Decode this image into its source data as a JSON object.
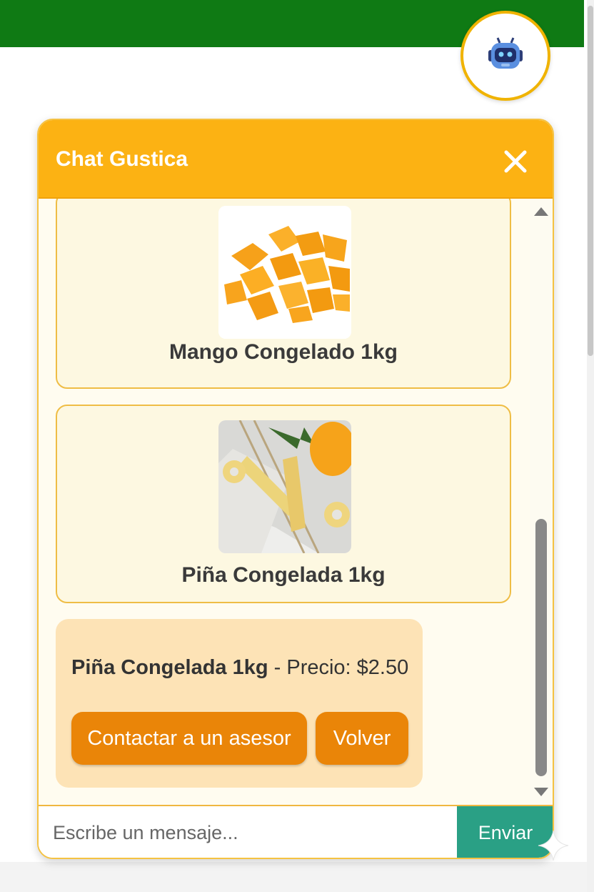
{
  "chat": {
    "title": "Chat Gustica",
    "products": [
      {
        "name": "Mango Congelado 1kg"
      },
      {
        "name": "Piña Congelada 1kg"
      }
    ],
    "selected": {
      "name": "Piña Congelada 1kg",
      "price_text": " - Precio: $2.50"
    },
    "buttons": {
      "contact": "Contactar a un asesor",
      "back": "Volver"
    },
    "input": {
      "placeholder": "Escribe un mensaje...",
      "send_label": "Enviar"
    }
  },
  "colors": {
    "topbar": "#0f7a14",
    "header": "#fcb213",
    "button": "#ea8508",
    "send": "#2aa085",
    "bubble": "#fde3b6"
  },
  "icons": [
    "robot-icon",
    "close-icon",
    "scroll-up-icon",
    "scroll-down-icon",
    "sparkle-icon"
  ]
}
